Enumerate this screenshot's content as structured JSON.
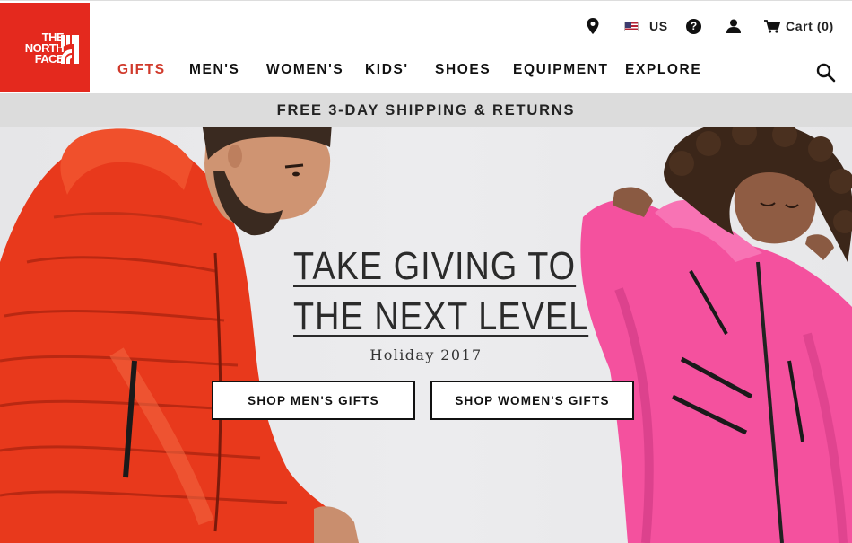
{
  "brand": {
    "logo_lines": [
      "THE",
      "NORTH",
      "FACE"
    ],
    "logo_color": "#e4291e",
    "registered_mark": "®"
  },
  "utility_nav": {
    "location_icon": "map-pin-icon",
    "country": "US",
    "country_icon": "us-flag-icon",
    "help_icon": "question-circle-icon",
    "help_glyph": "?",
    "account_icon": "user-icon",
    "cart_icon": "cart-icon",
    "cart_label": "Cart (0)"
  },
  "main_nav": {
    "items": [
      {
        "label": "GIFTS",
        "active": true
      },
      {
        "label": "MEN'S"
      },
      {
        "label": "WOMEN'S"
      },
      {
        "label": "KIDS'"
      },
      {
        "label": "SHOES"
      },
      {
        "label": "EQUIPMENT"
      },
      {
        "label": "EXPLORE"
      }
    ],
    "active_color": "#d0392b",
    "search_icon": "search-icon"
  },
  "promo_bar": {
    "text": "FREE 3-DAY SHIPPING & RETURNS"
  },
  "hero": {
    "headline_line1": "TAKE GIVING TO",
    "headline_line2": "THE NEXT LEVEL",
    "subtitle": "Holiday 2017",
    "cta_men": "SHOP MEN'S GIFTS",
    "cta_women": "SHOP WOMEN'S GIFTS",
    "men_jacket_color": "#ea3a1c",
    "women_jacket_color": "#f25aa3"
  }
}
